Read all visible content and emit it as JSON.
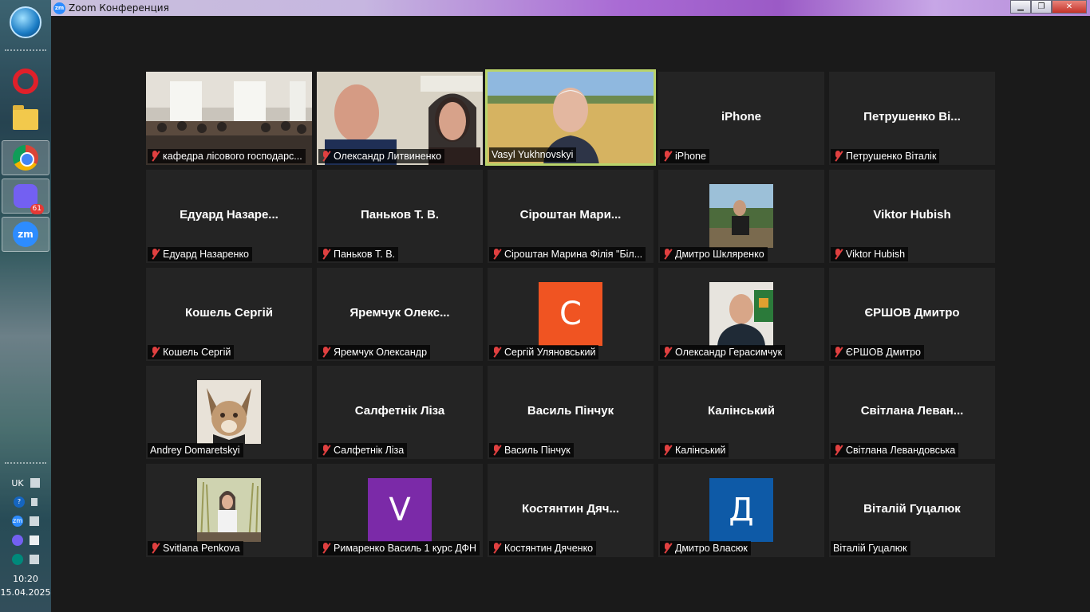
{
  "taskbar": {
    "badges": {
      "viber": "61"
    },
    "language": "UK",
    "clock": {
      "time": "10:20",
      "date": "15.04.2025"
    }
  },
  "window": {
    "title": "Zoom Конференция",
    "app_icon_text": "zm"
  },
  "participants": [
    {
      "label": "кафедра лісового господарс...",
      "video": "classroom",
      "muted": true
    },
    {
      "label": "Олександр Литвиненко",
      "video": "two-people",
      "muted": true
    },
    {
      "label": "Vasyl Yukhnovskyi",
      "video": "speaker",
      "muted": false,
      "active_speaker": true
    },
    {
      "center": "iPhone",
      "label": "iPhone",
      "muted": true
    },
    {
      "center": "Петрушенко  Ві...",
      "label": "Петрушенко Віталік",
      "muted": true
    },
    {
      "center": "Едуард  Назаре...",
      "label": "Едуард Назаренко",
      "muted": true
    },
    {
      "center": "Паньков Т. В.",
      "label": "Паньков Т. В.",
      "muted": true
    },
    {
      "center": "Сіроштан  Мари...",
      "label": "Сіроштан Марина Філія \"Біл...",
      "muted": true
    },
    {
      "label": "Дмитро Шкляренко",
      "photo": "outdoor-man",
      "muted": true
    },
    {
      "center": "Viktor Hubish",
      "label": "Viktor Hubish",
      "muted": true
    },
    {
      "center": "Кошель Сергій",
      "label": "Кошель Сергій",
      "muted": true
    },
    {
      "center": "Яремчук  Олекс...",
      "label": "Яремчук Олександр",
      "muted": true
    },
    {
      "label": "Сергій Уляновський",
      "avatar_letter": "С",
      "avatar_color": "#f05422",
      "muted": true
    },
    {
      "label": "Олександр Герасимчук",
      "photo": "portrait-man",
      "muted": true
    },
    {
      "center": "ЄРШОВ Дмитро",
      "label": "ЄРШОВ Дмитро",
      "muted": true
    },
    {
      "label": "Andrey Domaretskyi",
      "photo": "caracal",
      "muted": false
    },
    {
      "center": "Салфетнік Ліза",
      "label": "Салфетнік Ліза",
      "muted": true
    },
    {
      "center": "Василь Пінчук",
      "label": "Василь Пінчук",
      "muted": true
    },
    {
      "center": "Калінський",
      "label": "Калінський",
      "muted": true
    },
    {
      "center": "Світлана  Леван...",
      "label": "Світлана Левандовська",
      "muted": true
    },
    {
      "label": "Svitlana Penkova",
      "photo": "woman-grass",
      "muted": true
    },
    {
      "label": "Римаренко Василь 1 курс ДФН",
      "avatar_letter": "V",
      "avatar_color": "#7b2aa8",
      "muted": true
    },
    {
      "center": "Костянтин  Дяч...",
      "label": "Костянтин Дяченко",
      "muted": true
    },
    {
      "label": "Дмитро Власюк",
      "avatar_letter": "Д",
      "avatar_color": "#0e5aa7",
      "muted": true
    },
    {
      "center": "Віталій Гуцалюк",
      "label": "Віталій Гуцалюк",
      "muted": false
    }
  ]
}
